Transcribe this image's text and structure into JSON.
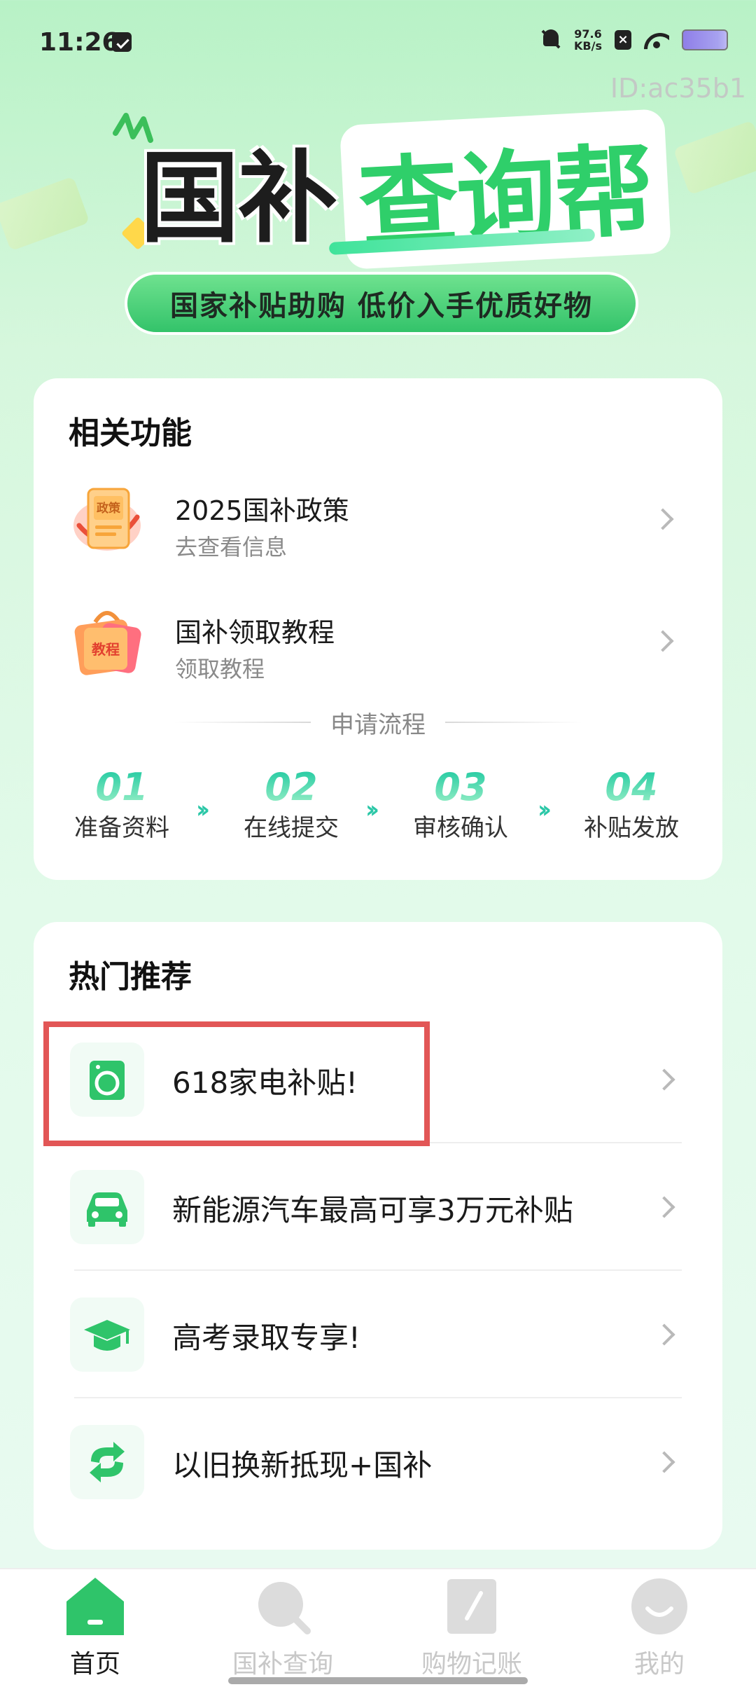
{
  "status_bar": {
    "time": "11:26",
    "net_speed_value": "97.6",
    "net_speed_unit": "KB/s"
  },
  "page_id": "ID:ac35b1",
  "hero": {
    "title_part_a": "国补",
    "title_part_b": "查询帮",
    "slogan": "国家补贴助购 低价入手优质好物"
  },
  "functions": {
    "title": "相关功能",
    "items": [
      {
        "name": "2025国补政策",
        "sub": "去查看信息",
        "badge": "政策"
      },
      {
        "name": "国补领取教程",
        "sub": "领取教程",
        "badge": "教程"
      }
    ],
    "flow_title": "申请流程",
    "steps": [
      {
        "num": "01",
        "label": "准备资料"
      },
      {
        "num": "02",
        "label": "在线提交"
      },
      {
        "num": "03",
        "label": "审核确认"
      },
      {
        "num": "04",
        "label": "补贴发放"
      }
    ]
  },
  "hot": {
    "title": "热门推荐",
    "items": [
      {
        "label": "618家电补贴!",
        "icon": "washing-machine-icon"
      },
      {
        "label": "新能源汽车最高可享3万元补贴",
        "icon": "car-icon"
      },
      {
        "label": "高考录取专享!",
        "icon": "graduation-cap-icon"
      },
      {
        "label": "以旧换新抵现+国补",
        "icon": "exchange-icon"
      }
    ]
  },
  "nav": {
    "items": [
      {
        "label": "首页",
        "active": true
      },
      {
        "label": "国补查询",
        "active": false
      },
      {
        "label": "购物记账",
        "active": false
      },
      {
        "label": "我的",
        "active": false
      }
    ]
  },
  "colors": {
    "accent_green": "#2fc46a",
    "highlight_red": "#e25656"
  }
}
